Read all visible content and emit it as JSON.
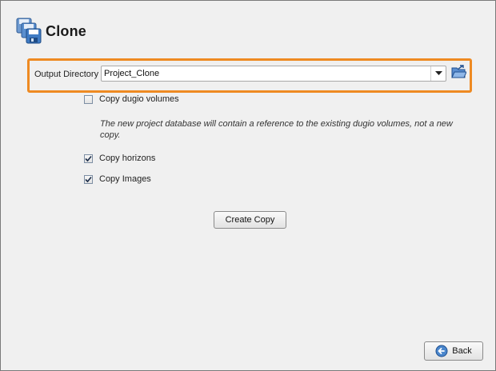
{
  "page": {
    "title": "Clone"
  },
  "output": {
    "label": "Output Directory",
    "value": "Project_Clone"
  },
  "options": {
    "dugio": {
      "label": "Copy dugio volumes",
      "checked": false
    },
    "note": "The new project database will contain a reference to the existing dugio volumes, not a new copy.",
    "horizons": {
      "label": "Copy horizons",
      "checked": true
    },
    "images": {
      "label": "Copy Images",
      "checked": true
    }
  },
  "actions": {
    "create_label": "Create Copy",
    "back_label": "Back"
  },
  "colors": {
    "highlight": "#ee8a22",
    "background": "#f0f0f0"
  },
  "icons": {
    "app": "clone-save-icon",
    "browse": "folder-open-icon",
    "dropdown": "chevron-down-icon",
    "back": "back-arrow-icon"
  }
}
